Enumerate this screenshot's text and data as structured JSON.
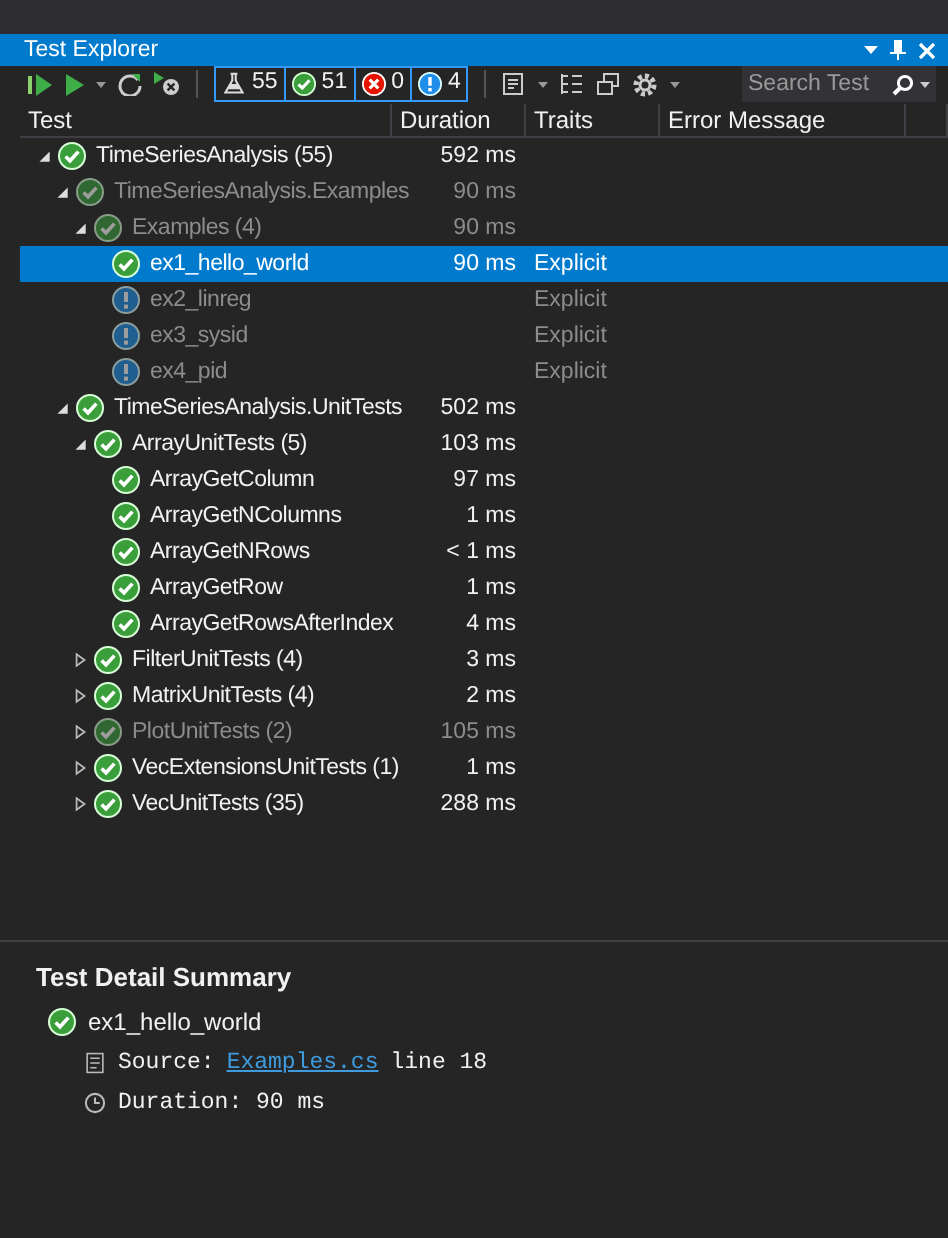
{
  "window": {
    "title": "Test Explorer"
  },
  "toolbar": {
    "counts": [
      {
        "kind": "total",
        "label": "55"
      },
      {
        "kind": "passed",
        "label": "51"
      },
      {
        "kind": "failed",
        "label": "0"
      },
      {
        "kind": "skipped",
        "label": "4"
      }
    ],
    "search": {
      "placeholder": "Search Test"
    }
  },
  "table": {
    "columns": [
      "Test",
      "Duration",
      "Traits",
      "Error Message"
    ],
    "rows": [
      {
        "name": "TimeSeriesAnalysis (55)",
        "duration": "592 ms",
        "kind": "passed",
        "dimmed": false,
        "expanded": true,
        "selected": false,
        "children": [
          {
            "name": "TimeSeriesAnalysis.Examples",
            "duration": "90 ms",
            "kind": "passed",
            "dimmed": true,
            "expanded": true,
            "selected": false,
            "children": [
              {
                "name": "Examples (4)",
                "duration": "90 ms",
                "kind": "passed",
                "dimmed": true,
                "expanded": true,
                "selected": false,
                "children": [
                  {
                    "name": "ex1_hello_world",
                    "duration": "90 ms",
                    "traits": "Explicit",
                    "kind": "passed",
                    "dimmed": false,
                    "selected": true
                  },
                  {
                    "name": "ex2_linreg",
                    "traits": "Explicit",
                    "kind": "skipped",
                    "dimmed": true,
                    "selected": false
                  },
                  {
                    "name": "ex3_sysid",
                    "traits": "Explicit",
                    "kind": "skipped",
                    "dimmed": true,
                    "selected": false
                  },
                  {
                    "name": "ex4_pid",
                    "traits": "Explicit",
                    "kind": "skipped",
                    "dimmed": true,
                    "selected": false
                  }
                ]
              }
            ]
          },
          {
            "name": "TimeSeriesAnalysis.UnitTests",
            "duration": "502 ms",
            "kind": "passed",
            "dimmed": false,
            "expanded": true,
            "selected": false,
            "children": [
              {
                "name": "ArrayUnitTests (5)",
                "duration": "103 ms",
                "kind": "passed",
                "dimmed": false,
                "expanded": true,
                "selected": false,
                "children": [
                  {
                    "name": "ArrayGetColumn",
                    "duration": "97 ms",
                    "kind": "passed",
                    "dimmed": false,
                    "selected": false
                  },
                  {
                    "name": "ArrayGetNColumns",
                    "duration": "1 ms",
                    "kind": "passed",
                    "dimmed": false,
                    "selected": false
                  },
                  {
                    "name": "ArrayGetNRows",
                    "duration": "< 1 ms",
                    "kind": "passed",
                    "dimmed": false,
                    "selected": false
                  },
                  {
                    "name": "ArrayGetRow",
                    "duration": "1 ms",
                    "kind": "passed",
                    "dimmed": false,
                    "selected": false
                  },
                  {
                    "name": "ArrayGetRowsAfterIndex",
                    "duration": "4 ms",
                    "kind": "passed",
                    "dimmed": false,
                    "selected": false
                  }
                ]
              },
              {
                "name": "FilterUnitTests (4)",
                "duration": "3 ms",
                "kind": "passed",
                "dimmed": false,
                "expanded": false,
                "selected": false
              },
              {
                "name": "MatrixUnitTests (4)",
                "duration": "2 ms",
                "kind": "passed",
                "dimmed": false,
                "expanded": false,
                "selected": false
              },
              {
                "name": "PlotUnitTests (2)",
                "duration": "105 ms",
                "kind": "passed",
                "dimmed": true,
                "expanded": false,
                "selected": false
              },
              {
                "name": "VecExtensionsUnitTests (1)",
                "duration": "1 ms",
                "kind": "passed",
                "dimmed": false,
                "expanded": false,
                "selected": false
              },
              {
                "name": "VecUnitTests (35)",
                "duration": "288 ms",
                "kind": "passed",
                "dimmed": false,
                "expanded": false,
                "selected": false
              }
            ]
          }
        ]
      }
    ]
  },
  "summary": {
    "title": "Test Detail Summary",
    "test": {
      "name": "ex1_hello_world",
      "kind": "passed"
    },
    "source": {
      "label": "Source:",
      "file": "Examples.cs",
      "line": "line 18"
    },
    "duration": {
      "label": "Duration:",
      "value": "90 ms"
    }
  }
}
